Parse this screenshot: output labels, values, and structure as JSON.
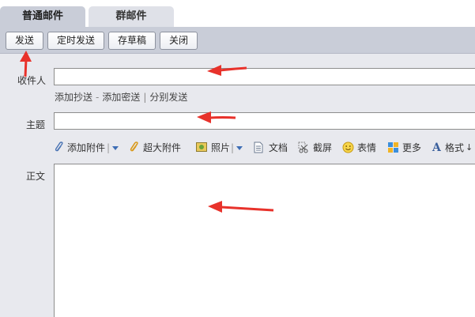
{
  "tabs": [
    {
      "label": "普通邮件",
      "active": true
    },
    {
      "label": "群邮件",
      "active": false
    }
  ],
  "toolbar": {
    "send": "发送",
    "scheduled_send": "定时发送",
    "save_draft": "存草稿",
    "close": "关闭"
  },
  "form": {
    "to_label": "收件人",
    "to_value": "",
    "cc_link": "添加抄送",
    "bcc_link": "添加密送",
    "separate_link": "分别发送",
    "subject_label": "主题",
    "subject_value": "",
    "body_label": "正文",
    "body_value": ""
  },
  "attachbar": {
    "add_attachment": "添加附件",
    "large_attachment": "超大附件",
    "photo": "照片",
    "document": "文档",
    "screenshot": "截屏",
    "emoji": "表情",
    "more": "更多",
    "format": "格式"
  },
  "colors": {
    "toolbar_bg": "#c9cdd8",
    "form_bg": "#e8e9ee",
    "arrow": "#e8322b"
  },
  "icons": [
    "paperclip-icon",
    "dropdown-triangle-icon",
    "photo-icon",
    "document-icon",
    "scissors-icon",
    "smiley-icon",
    "grid-icon",
    "font-a-icon"
  ]
}
